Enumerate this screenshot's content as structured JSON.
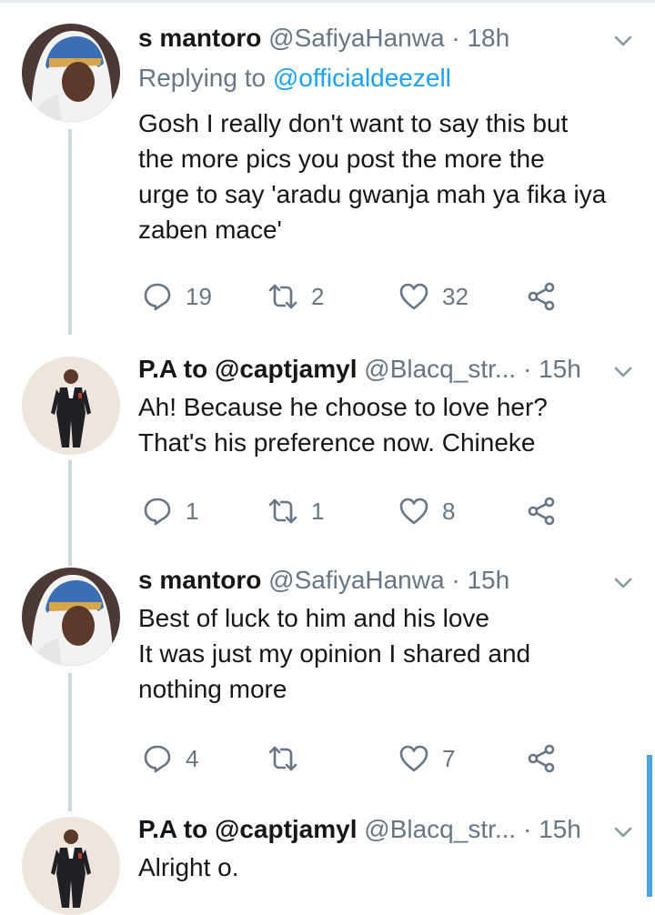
{
  "tweets": [
    {
      "name": "s mantoro",
      "handle": "@SafiyaHanwa",
      "time": "18h",
      "replying_prefix": "Replying to",
      "replying_handle": "@officialdeezell",
      "lines": [
        "Gosh I really don't want to say this but",
        "the more pics you post the more the",
        "urge to say 'aradu gwanja mah ya fika iya",
        "zaben mace'"
      ],
      "replies": "19",
      "retweets": "2",
      "likes": "32"
    },
    {
      "name": "P.A to @captjamyl",
      "handle": "@Blacq_str...",
      "time": "15h",
      "lines": [
        "Ah! Because he choose to love her?",
        "That's his preference now. Chineke"
      ],
      "replies": "1",
      "retweets": "1",
      "likes": "8"
    },
    {
      "name": "s mantoro",
      "handle": "@SafiyaHanwa",
      "time": "15h",
      "lines": [
        "Best of luck to him and his love",
        "It was just my opinion I shared and",
        "nothing more"
      ],
      "replies": "4",
      "retweets": "",
      "likes": "7"
    },
    {
      "name": "P.A to @captjamyl",
      "handle": "@Blacq_str...",
      "time": "15h",
      "lines": [
        "Alright o."
      ]
    }
  ],
  "separator": "·",
  "colors": {
    "text": "#14171a",
    "muted": "#657786",
    "link": "#1da1f2",
    "thread_line": "#ccd6dd"
  },
  "icons": {
    "reply": "reply-icon",
    "retweet": "retweet-icon",
    "like": "heart-icon",
    "share": "share-icon",
    "more": "chevron-down-icon"
  }
}
